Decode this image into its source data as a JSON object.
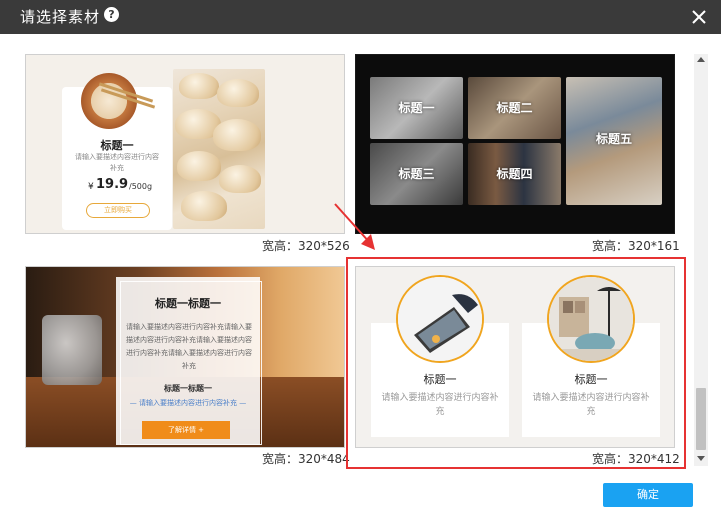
{
  "dialog": {
    "title": "请选择素材",
    "help_icon": "question-circle-icon",
    "close_icon": "close-icon",
    "confirm_label": "确定"
  },
  "materials": [
    {
      "size_label": "宽高：320*526",
      "title": "标题一",
      "desc": "请输入要描述内容进行内容补充",
      "price_currency": "¥",
      "price": "19.9",
      "price_unit": "/500g",
      "button": "立即购买"
    },
    {
      "size_label": "宽高：320*161",
      "tiles": [
        "标题一",
        "标题二",
        "标题三",
        "标题四",
        "标题五"
      ]
    },
    {
      "size_label": "宽高：320*484",
      "title": "标题一标题一",
      "desc": "请输入要描述内容进行内容补充请输入要描述内容进行内容补充请输入要描述内容进行内容补充请输入要描述内容进行内容补充",
      "subtitle": "标题一标题一",
      "sublink": "— 请输入要描述内容进行内容补充 —",
      "button": "了解详情 +"
    },
    {
      "size_label": "宽高：320*412",
      "items": [
        {
          "title": "标题一",
          "desc": "请输入要描述内容进行内容补充"
        },
        {
          "title": "标题一",
          "desc": "请输入要描述内容进行内容补充"
        }
      ]
    }
  ],
  "colors": {
    "titlebar": "#3a3a3a",
    "confirm": "#1aa2f2",
    "highlight": "#e63232",
    "accent_orange": "#f0a51f"
  }
}
